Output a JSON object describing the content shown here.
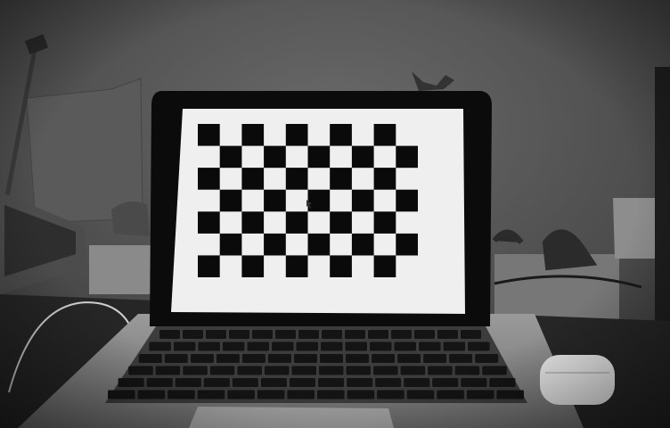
{
  "scene": {
    "checkerboard": {
      "cols": 10,
      "rows": 7,
      "shown_cells_note": ""
    },
    "colors": {
      "wall": "#5f5f5f",
      "screen": "#efefef",
      "bezel": "#0d0d0d",
      "laptop_body": "#8e8e8e",
      "key": "#141414",
      "desk": "#222222"
    }
  }
}
